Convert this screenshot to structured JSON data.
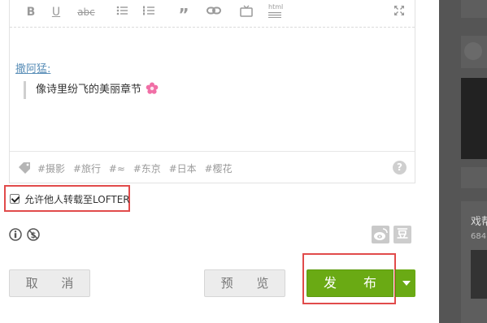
{
  "editor": {
    "toolbar": [
      "bold",
      "underline",
      "strikethrough",
      "bullet-list",
      "numbered-list",
      "quote",
      "link",
      "video",
      "html",
      "fullscreen"
    ],
    "html_label": "html",
    "mention": "撒阿猛:",
    "quote_text": "像诗里纷飞的美丽章节",
    "tags": [
      "#摄影",
      "#旅行",
      "#≈",
      "#东京",
      "#日本",
      "#樱花"
    ],
    "help_icon": "?"
  },
  "repost": {
    "checked": true,
    "label": "允许他人转载至LOFTER"
  },
  "share": {
    "weibo": "weibo-icon",
    "douban_label": "豆"
  },
  "buttons": {
    "cancel": "取 消",
    "preview": "预 览",
    "publish": "发 布"
  },
  "background": {
    "title": "戏帮",
    "count": "684"
  },
  "colors": {
    "publish": "#6aaa14",
    "highlight": "#e14b4b",
    "link": "#5b8fb8"
  }
}
